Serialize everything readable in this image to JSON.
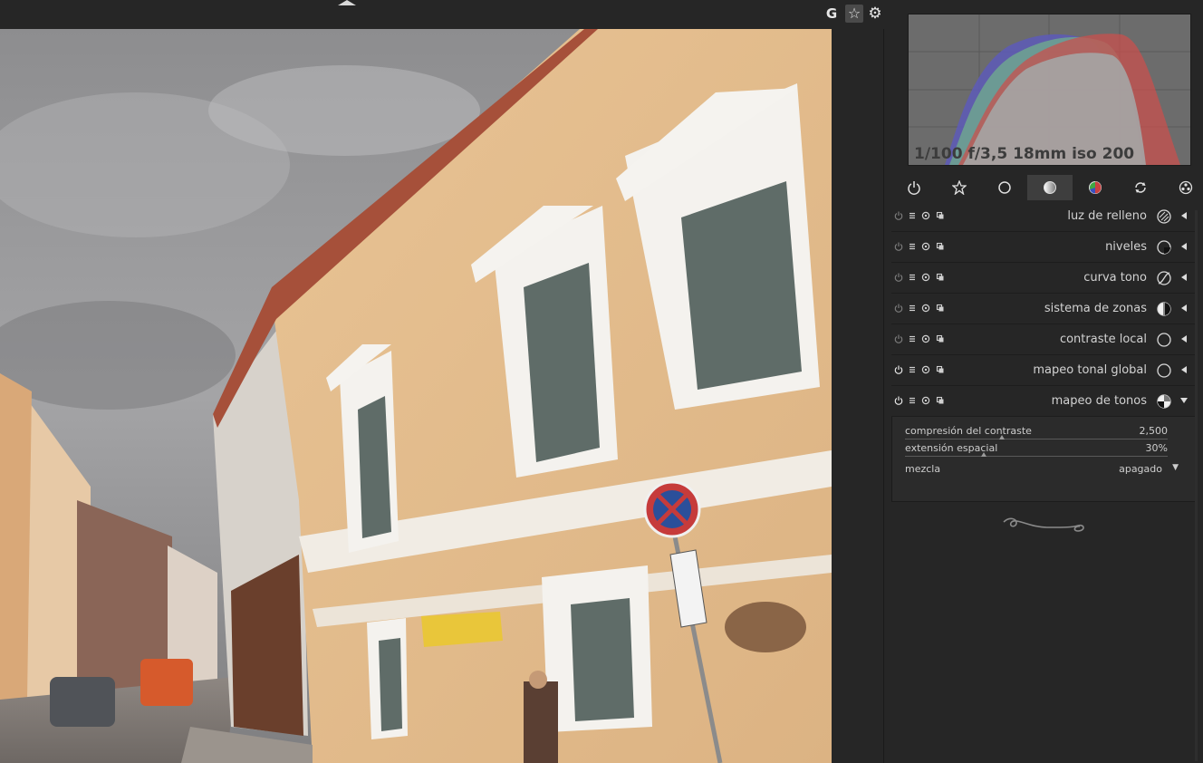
{
  "toolbar": {
    "grouping_label": "G",
    "overlays_icon": "star-icon",
    "preferences_icon": "gear-icon"
  },
  "histogram": {
    "exif_text": "1/100 f/3,5 18mm iso 200",
    "colors": {
      "red": "#c8504e",
      "green": "#7fb26c",
      "blue": "#5d5bb8"
    }
  },
  "module_groups": [
    {
      "name": "power-icon",
      "active": false
    },
    {
      "name": "star-icon",
      "active": false
    },
    {
      "name": "circle-icon",
      "active": false
    },
    {
      "name": "tone-icon",
      "active": true
    },
    {
      "name": "color-icon",
      "active": false
    },
    {
      "name": "correct-icon",
      "active": false
    },
    {
      "name": "effects-icon",
      "active": false
    }
  ],
  "modules": [
    {
      "name": "luz de relleno",
      "enabled": false,
      "expanded": false
    },
    {
      "name": "niveles",
      "enabled": false,
      "expanded": false
    },
    {
      "name": "curva tono",
      "enabled": false,
      "expanded": false
    },
    {
      "name": "sistema de zonas",
      "enabled": false,
      "expanded": false
    },
    {
      "name": "contraste local",
      "enabled": false,
      "expanded": false
    },
    {
      "name": "mapeo tonal global",
      "enabled": true,
      "expanded": false
    },
    {
      "name": "mapeo de tonos",
      "enabled": true,
      "expanded": true
    }
  ],
  "tonemap": {
    "contrast_label": "compresión del contraste",
    "contrast_value": "2,500",
    "contrast_level": 0.37,
    "spatial_label": "extensión espacial",
    "spatial_value": "30%",
    "spatial_level": 0.3,
    "blend_label": "mezcla",
    "blend_value": "apagado"
  },
  "colors": {
    "panel_bg": "#262626",
    "active_tab": "#3e3e3e",
    "text": "#d2d2d2"
  }
}
